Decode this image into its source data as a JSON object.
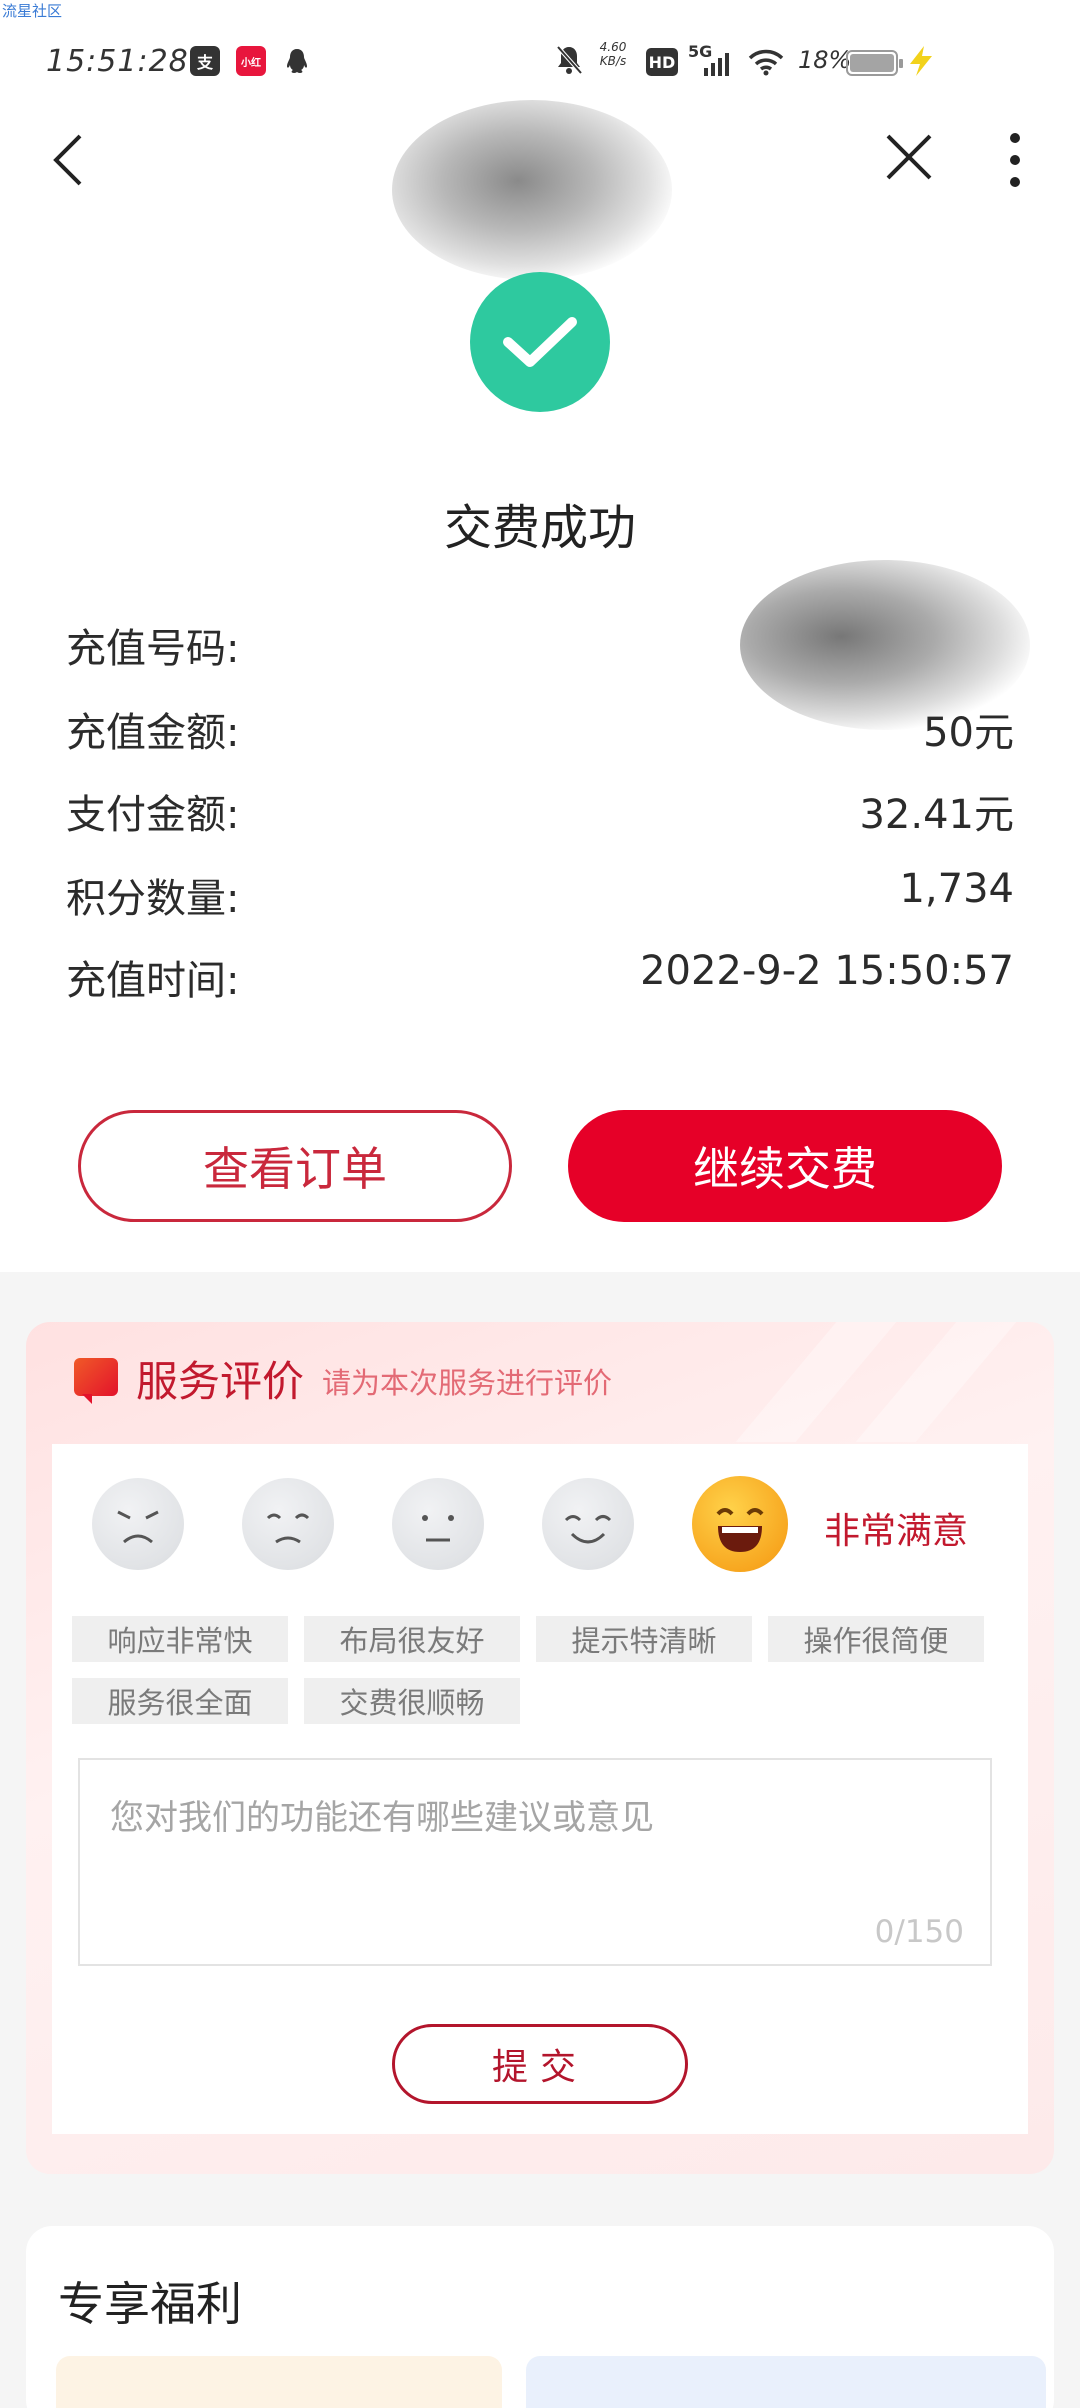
{
  "watermark": "流星社区",
  "status_bar": {
    "time": "15:51:28",
    "net_speed": "4.60 KB/s",
    "hd": "HD",
    "network": "5G",
    "battery_text": "18%"
  },
  "page": {
    "title": "交费成功"
  },
  "info": {
    "rows": [
      {
        "label": "充值号码:",
        "value": ""
      },
      {
        "label": "充值金额:",
        "value": "50元"
      },
      {
        "label": "支付金额:",
        "value": "32.41元"
      },
      {
        "label": "积分数量:",
        "value": "1,734"
      },
      {
        "label": "充值时间:",
        "value": "2022-9-2 15:50:57"
      }
    ]
  },
  "actions": {
    "view_order": "查看订单",
    "continue_pay": "继续交费"
  },
  "rating": {
    "title": "服务评价",
    "subtitle": "请为本次服务进行评价",
    "selected_label": "非常满意",
    "tags": [
      "响应非常快",
      "布局很友好",
      "提示特清晰",
      "操作很简便",
      "服务很全面",
      "交费很顺畅"
    ],
    "feedback_placeholder": "您对我们的功能还有哪些建议或意见",
    "counter": "0/150",
    "submit": "提交"
  },
  "benefits": {
    "title": "专享福利"
  },
  "colors": {
    "brand_red": "#e60028",
    "success_green": "#2ec99f"
  }
}
